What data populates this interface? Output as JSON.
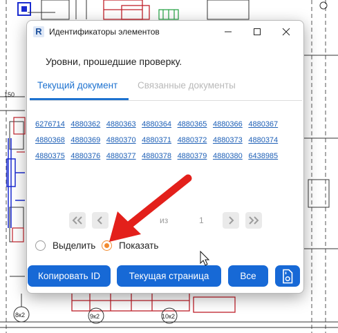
{
  "window": {
    "title": "Идентификаторы элементов",
    "app_icon_glyph": "R"
  },
  "heading": "Уровни, прошедшие проверку.",
  "tabs": [
    {
      "label": "Текущий документ",
      "active": true
    },
    {
      "label": "Связанные документы",
      "active": false
    }
  ],
  "ids": [
    "6276714",
    "4880362",
    "4880363",
    "4880364",
    "4880365",
    "4880366",
    "4880367",
    "4880368",
    "4880369",
    "4880370",
    "4880371",
    "4880372",
    "4880373",
    "4880374",
    "4880375",
    "4880376",
    "4880377",
    "4880378",
    "4880379",
    "4880380",
    "6438985"
  ],
  "pager": {
    "of_label": "из",
    "page": "1",
    "icons": [
      "double-chevron-left-icon",
      "chevron-left-icon",
      "chevron-right-icon",
      "double-chevron-right-icon"
    ]
  },
  "mode": {
    "options": [
      "Выделить",
      "Показать"
    ],
    "selected": "Показать"
  },
  "actions": {
    "copy_label": "Копировать ID",
    "page_label": "Текущая страница",
    "all_label": "Все",
    "file_icon": "file-icon"
  },
  "background": {
    "dim_label": "150",
    "marks": [
      "8к2",
      "9к2",
      "10к2"
    ]
  },
  "colors": {
    "accent": "#1769d6",
    "tab_active": "#1d72d0",
    "link": "#1d5fb6",
    "radio_selected": "#f28a2e",
    "annotation_arrow": "#e3201b"
  }
}
